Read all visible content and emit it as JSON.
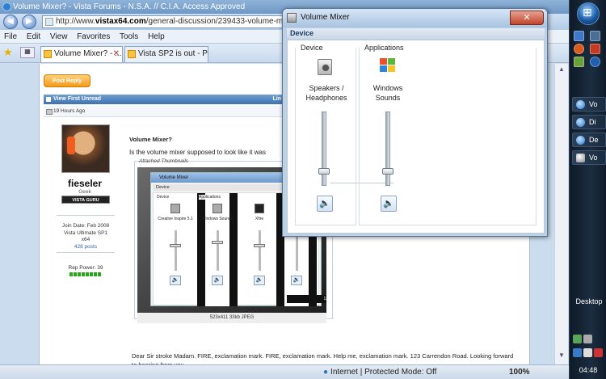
{
  "browser": {
    "window_title": "Volume Mixer? - Vista Forums - N.S.A. // C.I.A. Access Approved",
    "url_prefix": "http://www.",
    "url_domain": "vistax64.com",
    "url_path": "/general-discussion/239433-volume-mix",
    "menu": [
      "File",
      "Edit",
      "View",
      "Favorites",
      "Tools",
      "Help"
    ],
    "tabs": [
      {
        "label": "Volume Mixer? - ...",
        "active": true
      },
      {
        "label": "Vista SP2 is out - Pa...",
        "active": false
      }
    ],
    "status_zone": "Internet | Protected Mode: Off",
    "zoom": "100%"
  },
  "forum": {
    "post_reply": "Post Reply",
    "view_first_unread": "View First Unread",
    "bar_right": "Lin",
    "post_date": "19 Hours Ago",
    "user": {
      "name": "fieseler",
      "title": "Geek",
      "badge": "VISTA GURU",
      "join_date": "Join Date: Feb 2008",
      "os": "Vista Ultimate SP1",
      "arch": "x64",
      "posts": "428 posts",
      "rep_power": "Rep Power: 39"
    },
    "post_title": "Volume Mixer?",
    "post_text": "Is the volume mixer supposed to look like it was",
    "attached_label": "Attached Thumbnails",
    "thumbnail": {
      "window_title": "Volume Mixer",
      "device_label": "Device",
      "columns": [
        {
          "header": "Device",
          "name": "Creative Inspire 5.1"
        },
        {
          "header": "Applications",
          "name": "Windows Sounds"
        },
        {
          "header": "",
          "name": "Xfire"
        },
        {
          "header": "",
          "name": "N"
        }
      ],
      "tray_time": "13:48",
      "caption": "523x411  33kb  JPEG"
    },
    "reply_text": "Dear Sir stroke Madam. FIRE, exclamation mark. FIRE, exclamation mark. Help me, exclamation mark. 123 Carrendon Road. Looking forward to hearing from you."
  },
  "mixer": {
    "title": "Volume Mixer",
    "close_glyph": "✕",
    "device_bar": "Device",
    "device_group": "Device",
    "apps_group": "Applications",
    "device_name_line1": "Speakers /",
    "device_name_line2": "Headphones",
    "app_name_line1": "Windows",
    "app_name_line2": "Sounds",
    "device_level": 0.2,
    "app_level": 0.2,
    "mute_glyph": "🔈"
  },
  "taskbar": {
    "buttons": [
      "Vo",
      "Di",
      "De",
      "Vo"
    ],
    "desktop_label": "Desktop",
    "clock": "04:48"
  },
  "colors": {
    "accent_blue": "#3f72ad",
    "post_reply_orange": "#f39a1b",
    "guru_green": "#2aa61c"
  }
}
